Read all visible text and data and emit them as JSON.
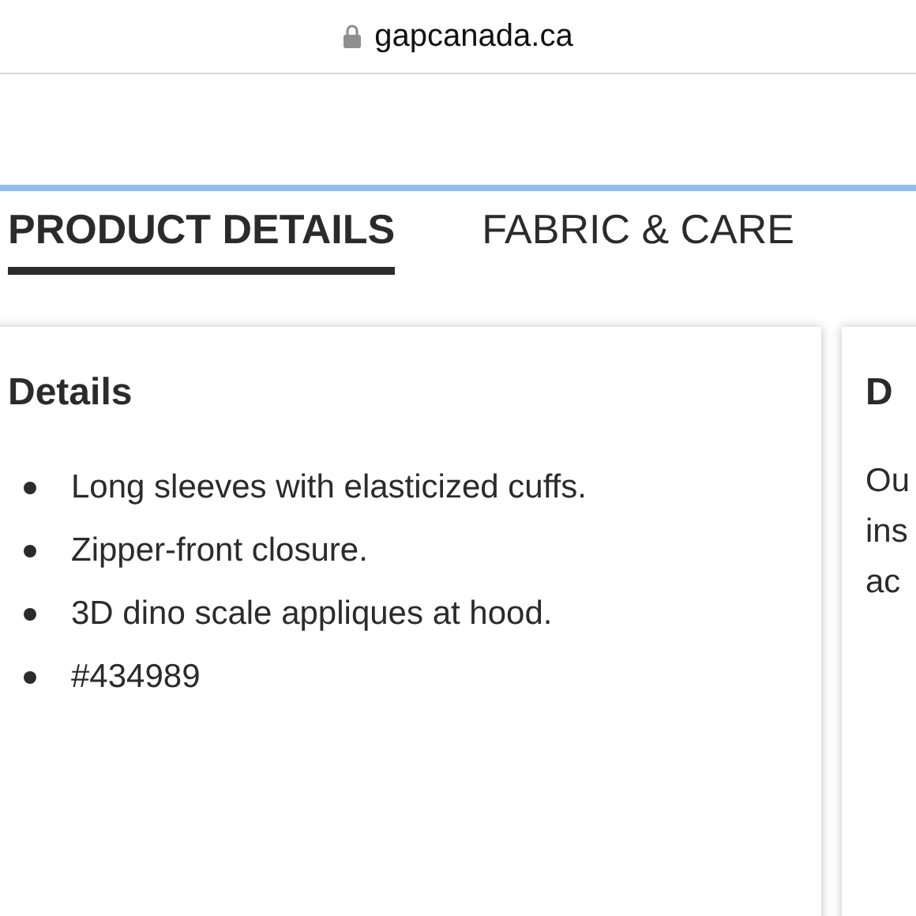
{
  "address_bar": {
    "url": "gapcanada.ca"
  },
  "tabs": [
    {
      "label": "PRODUCT DETAILS",
      "selected": true
    },
    {
      "label": "FABRIC & CARE",
      "selected": false
    }
  ],
  "cards": [
    {
      "title": "Details",
      "items": [
        "Long sleeves with elasticized cuffs.",
        "Zipper-front closure.",
        "3D dino scale appliques at hood.",
        "#434989"
      ]
    },
    {
      "title": "D",
      "lines": [
        "Ou",
        "ins",
        "ac"
      ]
    }
  ]
}
